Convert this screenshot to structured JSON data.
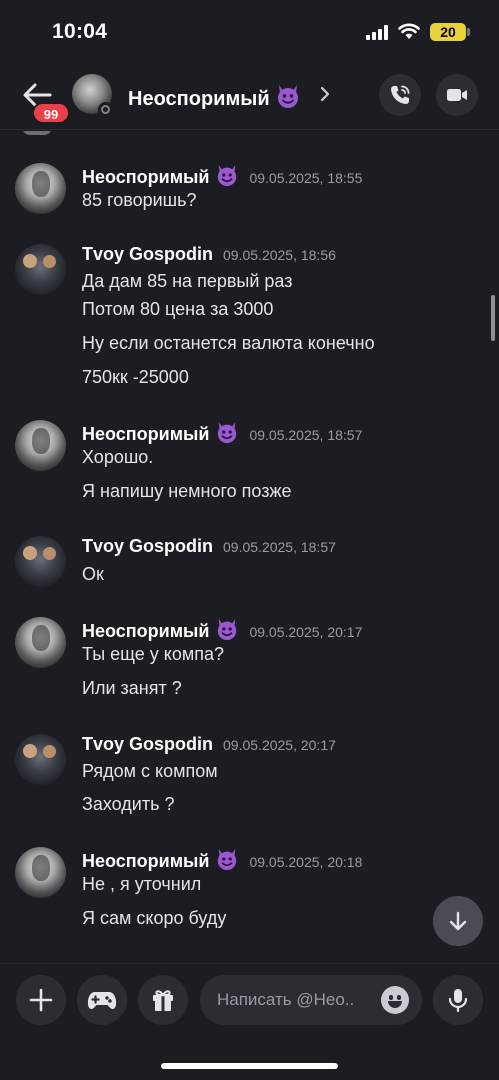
{
  "status_bar": {
    "time": "10:04",
    "battery": "20"
  },
  "header": {
    "back_icon": "arrow-left-icon",
    "unread_badge": "99",
    "title": "Неоспоримый",
    "title_emoji": "smiling-imp-emoji",
    "call_icon": "phone-call-icon",
    "video_icon": "video-camera-icon"
  },
  "messages": [
    {
      "author": "Неоспоримый",
      "emoji": true,
      "time": "09.05.2025, 18:55",
      "lines": [
        "85 говоришь?"
      ]
    },
    {
      "author": "Tvoy Gospodin",
      "emoji": false,
      "time": "09.05.2025, 18:56",
      "lines": [
        "Да дам 85 на первый раз",
        "Потом 80 цена за 3000",
        "Ну если останется валюта конечно",
        "750кк -25000"
      ]
    },
    {
      "author": "Неоспоримый",
      "emoji": true,
      "time": "09.05.2025, 18:57",
      "lines": [
        "Хорошо.",
        "Я напишу немного позже"
      ]
    },
    {
      "author": "Tvoy Gospodin",
      "emoji": false,
      "time": "09.05.2025, 18:57",
      "lines": [
        "Ок"
      ]
    },
    {
      "author": "Неоспоримый",
      "emoji": true,
      "time": "09.05.2025, 20:17",
      "lines": [
        "Ты еще у компа?",
        "Или занят ?"
      ]
    },
    {
      "author": "Tvoy Gospodin",
      "emoji": false,
      "time": "09.05.2025, 20:17",
      "lines": [
        "Рядом с компом",
        "Заходить ?"
      ]
    },
    {
      "author": "Неоспоримый",
      "emoji": true,
      "time": "09.05.2025, 20:18",
      "lines": [
        "Не , я уточнил",
        "Я сам скоро буду"
      ]
    }
  ],
  "composer": {
    "placeholder": "Написать @Нео..",
    "plus_icon": "plus-icon",
    "game_icon": "gamepad-icon",
    "gift_icon": "gift-icon",
    "emoji_icon": "smile-icon",
    "mic_icon": "microphone-icon"
  },
  "jump_icon": "arrow-down-icon",
  "colors": {
    "background": "#1c1d22",
    "badge": "#e8414a",
    "battery": "#e8d23a",
    "emoji": "#9b59d0"
  }
}
